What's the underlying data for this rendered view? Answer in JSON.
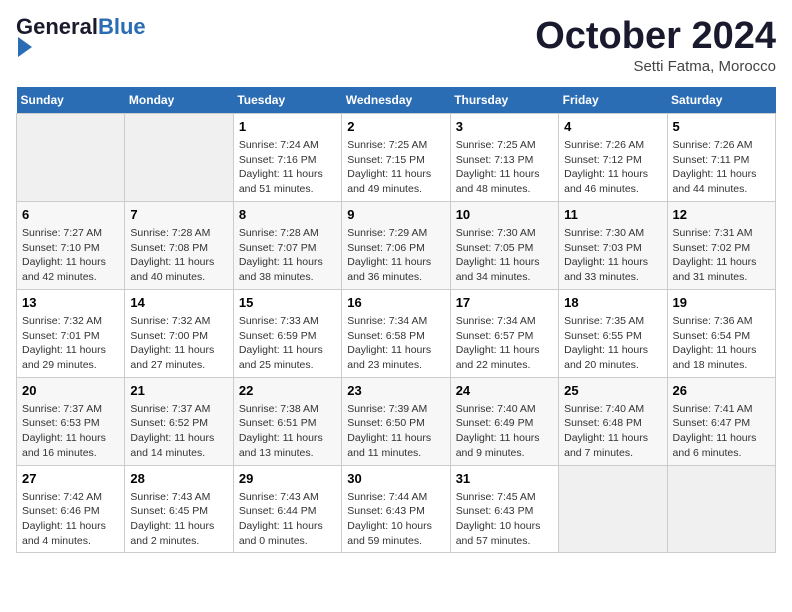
{
  "header": {
    "logo_general": "General",
    "logo_blue": "Blue",
    "month": "October 2024",
    "location": "Setti Fatma, Morocco"
  },
  "days_of_week": [
    "Sunday",
    "Monday",
    "Tuesday",
    "Wednesday",
    "Thursday",
    "Friday",
    "Saturday"
  ],
  "weeks": [
    [
      {
        "day": "",
        "sunrise": "",
        "sunset": "",
        "daylight": ""
      },
      {
        "day": "",
        "sunrise": "",
        "sunset": "",
        "daylight": ""
      },
      {
        "day": "1",
        "sunrise": "Sunrise: 7:24 AM",
        "sunset": "Sunset: 7:16 PM",
        "daylight": "Daylight: 11 hours and 51 minutes."
      },
      {
        "day": "2",
        "sunrise": "Sunrise: 7:25 AM",
        "sunset": "Sunset: 7:15 PM",
        "daylight": "Daylight: 11 hours and 49 minutes."
      },
      {
        "day": "3",
        "sunrise": "Sunrise: 7:25 AM",
        "sunset": "Sunset: 7:13 PM",
        "daylight": "Daylight: 11 hours and 48 minutes."
      },
      {
        "day": "4",
        "sunrise": "Sunrise: 7:26 AM",
        "sunset": "Sunset: 7:12 PM",
        "daylight": "Daylight: 11 hours and 46 minutes."
      },
      {
        "day": "5",
        "sunrise": "Sunrise: 7:26 AM",
        "sunset": "Sunset: 7:11 PM",
        "daylight": "Daylight: 11 hours and 44 minutes."
      }
    ],
    [
      {
        "day": "6",
        "sunrise": "Sunrise: 7:27 AM",
        "sunset": "Sunset: 7:10 PM",
        "daylight": "Daylight: 11 hours and 42 minutes."
      },
      {
        "day": "7",
        "sunrise": "Sunrise: 7:28 AM",
        "sunset": "Sunset: 7:08 PM",
        "daylight": "Daylight: 11 hours and 40 minutes."
      },
      {
        "day": "8",
        "sunrise": "Sunrise: 7:28 AM",
        "sunset": "Sunset: 7:07 PM",
        "daylight": "Daylight: 11 hours and 38 minutes."
      },
      {
        "day": "9",
        "sunrise": "Sunrise: 7:29 AM",
        "sunset": "Sunset: 7:06 PM",
        "daylight": "Daylight: 11 hours and 36 minutes."
      },
      {
        "day": "10",
        "sunrise": "Sunrise: 7:30 AM",
        "sunset": "Sunset: 7:05 PM",
        "daylight": "Daylight: 11 hours and 34 minutes."
      },
      {
        "day": "11",
        "sunrise": "Sunrise: 7:30 AM",
        "sunset": "Sunset: 7:03 PM",
        "daylight": "Daylight: 11 hours and 33 minutes."
      },
      {
        "day": "12",
        "sunrise": "Sunrise: 7:31 AM",
        "sunset": "Sunset: 7:02 PM",
        "daylight": "Daylight: 11 hours and 31 minutes."
      }
    ],
    [
      {
        "day": "13",
        "sunrise": "Sunrise: 7:32 AM",
        "sunset": "Sunset: 7:01 PM",
        "daylight": "Daylight: 11 hours and 29 minutes."
      },
      {
        "day": "14",
        "sunrise": "Sunrise: 7:32 AM",
        "sunset": "Sunset: 7:00 PM",
        "daylight": "Daylight: 11 hours and 27 minutes."
      },
      {
        "day": "15",
        "sunrise": "Sunrise: 7:33 AM",
        "sunset": "Sunset: 6:59 PM",
        "daylight": "Daylight: 11 hours and 25 minutes."
      },
      {
        "day": "16",
        "sunrise": "Sunrise: 7:34 AM",
        "sunset": "Sunset: 6:58 PM",
        "daylight": "Daylight: 11 hours and 23 minutes."
      },
      {
        "day": "17",
        "sunrise": "Sunrise: 7:34 AM",
        "sunset": "Sunset: 6:57 PM",
        "daylight": "Daylight: 11 hours and 22 minutes."
      },
      {
        "day": "18",
        "sunrise": "Sunrise: 7:35 AM",
        "sunset": "Sunset: 6:55 PM",
        "daylight": "Daylight: 11 hours and 20 minutes."
      },
      {
        "day": "19",
        "sunrise": "Sunrise: 7:36 AM",
        "sunset": "Sunset: 6:54 PM",
        "daylight": "Daylight: 11 hours and 18 minutes."
      }
    ],
    [
      {
        "day": "20",
        "sunrise": "Sunrise: 7:37 AM",
        "sunset": "Sunset: 6:53 PM",
        "daylight": "Daylight: 11 hours and 16 minutes."
      },
      {
        "day": "21",
        "sunrise": "Sunrise: 7:37 AM",
        "sunset": "Sunset: 6:52 PM",
        "daylight": "Daylight: 11 hours and 14 minutes."
      },
      {
        "day": "22",
        "sunrise": "Sunrise: 7:38 AM",
        "sunset": "Sunset: 6:51 PM",
        "daylight": "Daylight: 11 hours and 13 minutes."
      },
      {
        "day": "23",
        "sunrise": "Sunrise: 7:39 AM",
        "sunset": "Sunset: 6:50 PM",
        "daylight": "Daylight: 11 hours and 11 minutes."
      },
      {
        "day": "24",
        "sunrise": "Sunrise: 7:40 AM",
        "sunset": "Sunset: 6:49 PM",
        "daylight": "Daylight: 11 hours and 9 minutes."
      },
      {
        "day": "25",
        "sunrise": "Sunrise: 7:40 AM",
        "sunset": "Sunset: 6:48 PM",
        "daylight": "Daylight: 11 hours and 7 minutes."
      },
      {
        "day": "26",
        "sunrise": "Sunrise: 7:41 AM",
        "sunset": "Sunset: 6:47 PM",
        "daylight": "Daylight: 11 hours and 6 minutes."
      }
    ],
    [
      {
        "day": "27",
        "sunrise": "Sunrise: 7:42 AM",
        "sunset": "Sunset: 6:46 PM",
        "daylight": "Daylight: 11 hours and 4 minutes."
      },
      {
        "day": "28",
        "sunrise": "Sunrise: 7:43 AM",
        "sunset": "Sunset: 6:45 PM",
        "daylight": "Daylight: 11 hours and 2 minutes."
      },
      {
        "day": "29",
        "sunrise": "Sunrise: 7:43 AM",
        "sunset": "Sunset: 6:44 PM",
        "daylight": "Daylight: 11 hours and 0 minutes."
      },
      {
        "day": "30",
        "sunrise": "Sunrise: 7:44 AM",
        "sunset": "Sunset: 6:43 PM",
        "daylight": "Daylight: 10 hours and 59 minutes."
      },
      {
        "day": "31",
        "sunrise": "Sunrise: 7:45 AM",
        "sunset": "Sunset: 6:43 PM",
        "daylight": "Daylight: 10 hours and 57 minutes."
      },
      {
        "day": "",
        "sunrise": "",
        "sunset": "",
        "daylight": ""
      },
      {
        "day": "",
        "sunrise": "",
        "sunset": "",
        "daylight": ""
      }
    ]
  ]
}
